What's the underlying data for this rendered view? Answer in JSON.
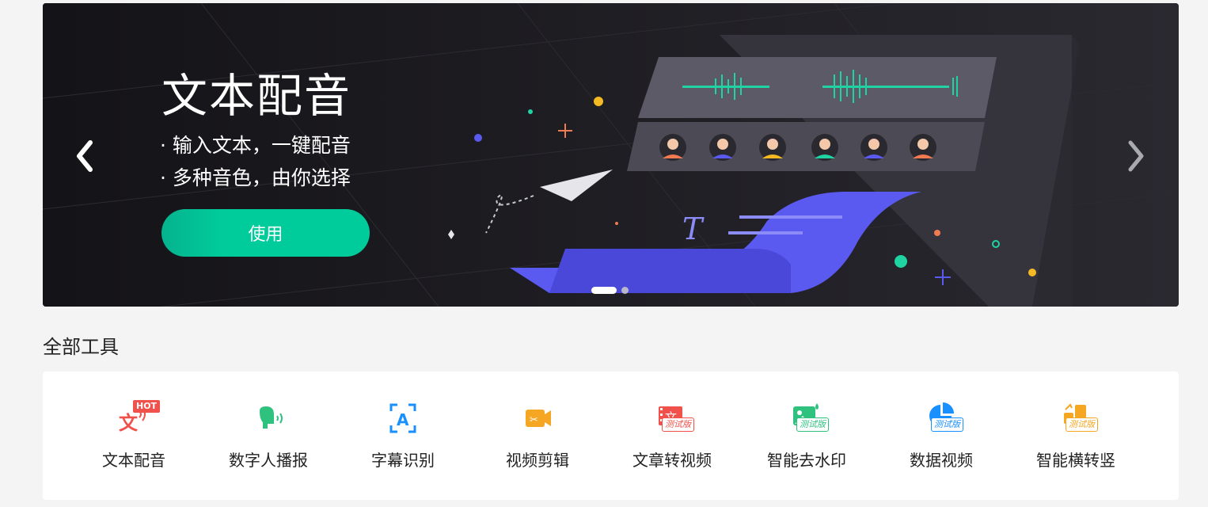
{
  "banner": {
    "title": "文本配音",
    "bullet1": "· 输入文本，一键配音",
    "bullet2": "· 多种音色，由你选择",
    "button_label": "使用",
    "prev_icon": "chevron-left-icon",
    "next_icon": "chevron-right-icon",
    "slides": 2,
    "active_slide": 1,
    "accent": "#00cc9b",
    "wave_color": "#00d4a0",
    "paper_color": "#5a5af0"
  },
  "section": {
    "title": "全部工具"
  },
  "tools": [
    {
      "label": "文本配音",
      "icon": "text-voice-icon",
      "badge": "HOT",
      "color": "#f0514a"
    },
    {
      "label": "数字人播报",
      "icon": "digital-human-icon",
      "badge": "",
      "color": "#2ec27e"
    },
    {
      "label": "字幕识别",
      "icon": "subtitle-recognition-icon",
      "badge": "",
      "color": "#1890ff"
    },
    {
      "label": "视频剪辑",
      "icon": "video-edit-icon",
      "badge": "",
      "color": "#f5a623"
    },
    {
      "label": "文章转视频",
      "icon": "article-to-video-icon",
      "badge": "测试版",
      "color": "#f0514a"
    },
    {
      "label": "智能去水印",
      "icon": "watermark-remove-icon",
      "badge": "测试版",
      "color": "#2ec27e"
    },
    {
      "label": "数据视频",
      "icon": "data-video-icon",
      "badge": "测试版",
      "color": "#1890ff"
    },
    {
      "label": "智能横转竖",
      "icon": "landscape-to-portrait-icon",
      "badge": "测试版",
      "color": "#f5a623"
    }
  ]
}
